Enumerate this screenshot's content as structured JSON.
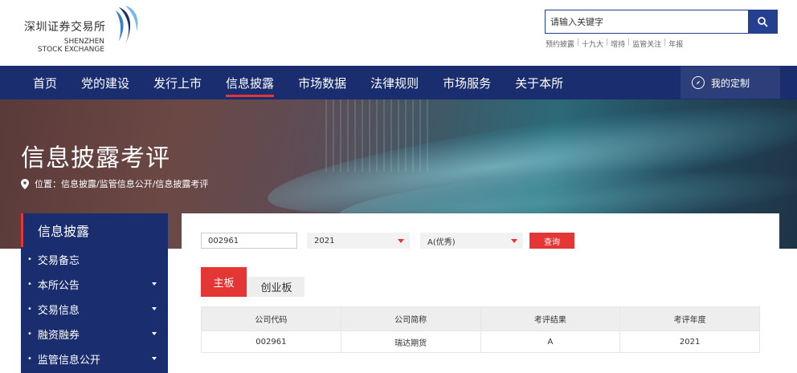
{
  "logo": {
    "name_cn": "深圳证券交易所",
    "name_en_1": "SHENZHEN",
    "name_en_2": "STOCK EXCHANGE",
    "icon": "szse-sail-logo-icon"
  },
  "search": {
    "placeholder": "请输入关键字",
    "icon": "search-icon",
    "hot_links": [
      "预约披露",
      "十九大",
      "增持",
      "监管关注",
      "年报"
    ]
  },
  "nav": {
    "items": [
      "首页",
      "党的建设",
      "发行上市",
      "信息披露",
      "市场数据",
      "法律规则",
      "市场服务",
      "关于本所"
    ],
    "active": "信息披露",
    "custom_label": "我的定制",
    "custom_icon": "compass-icon"
  },
  "banner": {
    "title": "信息披露考评",
    "breadcrumb": "位置：信息披露/监管信息公开/信息披露考评",
    "pin_icon": "location-pin-icon"
  },
  "sidebar": {
    "title": "信息披露",
    "items": [
      {
        "label": "交易备忘",
        "has_caret": false
      },
      {
        "label": "本所公告",
        "has_caret": true
      },
      {
        "label": "交易信息",
        "has_caret": true
      },
      {
        "label": "融资融券",
        "has_caret": true
      },
      {
        "label": "监管信息公开",
        "has_caret": true
      }
    ]
  },
  "filters": {
    "code_value": "002961",
    "year_value": "2021",
    "result_value": "A(优秀)",
    "query_label": "查询"
  },
  "tabs": {
    "main_board": "主板",
    "chinext": "创业板"
  },
  "table": {
    "headers": [
      "公司代码",
      "公司简称",
      "考评结果",
      "考评年度"
    ],
    "rows": [
      [
        "002961",
        "瑞达期货",
        "A",
        "2021"
      ]
    ]
  },
  "colors": {
    "brand_blue": "#1a2d6e",
    "accent_red": "#e53636",
    "search_blue": "#24408e"
  }
}
